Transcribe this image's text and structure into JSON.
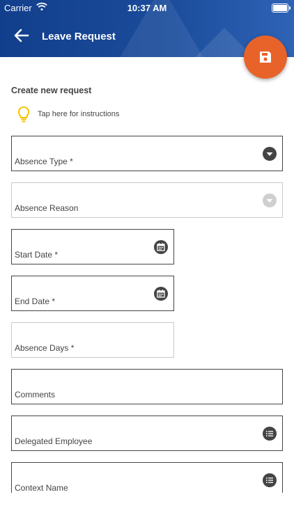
{
  "status_bar": {
    "carrier": "Carrier",
    "time": "10:37 AM"
  },
  "header": {
    "title": "Leave Request",
    "back_icon": "arrow-left-icon",
    "save_icon": "save-icon"
  },
  "section_title": "Create new request",
  "hint": {
    "text": "Tap here for instructions",
    "icon": "lightbulb-icon"
  },
  "fields": {
    "absence_type": {
      "label": "Absence Type *",
      "icon": "chevron-down-icon"
    },
    "absence_reason": {
      "label": "Absence Reason",
      "icon": "chevron-down-icon"
    },
    "start_date": {
      "label": "Start Date *",
      "icon": "calendar-icon"
    },
    "end_date": {
      "label": "End Date *",
      "icon": "calendar-icon"
    },
    "absence_days": {
      "label": "Absence Days *"
    },
    "comments": {
      "label": "Comments"
    },
    "delegated_employee": {
      "label": "Delegated Employee",
      "icon": "list-icon"
    },
    "context_name": {
      "label": "Context Name",
      "icon": "list-icon"
    }
  },
  "colors": {
    "header": "#1a4b9a",
    "fab": "#e8632a",
    "hint_icon": "#f2c200"
  }
}
